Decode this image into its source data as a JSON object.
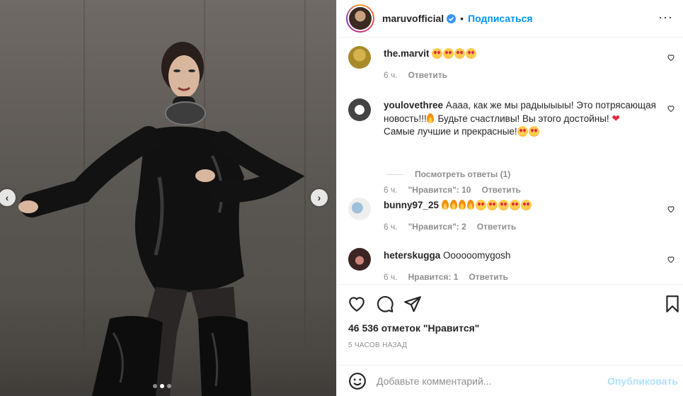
{
  "post": {
    "username": "maruvofficial",
    "follow_label": "Подписаться",
    "separator": "•",
    "more_label": "···"
  },
  "carousel": {
    "prev_label": "‹",
    "next_label": "›",
    "slides_count": 3,
    "active_slide": 2
  },
  "comments": [
    {
      "username": "the.marvit",
      "text": "",
      "emoji_after": [
        "star-struck",
        "star-struck",
        "star-struck",
        "star-struck"
      ],
      "time": "6 ч.",
      "reply_label": "Ответить"
    },
    {
      "username": "youlovethree",
      "text_part1": "Аааа, как же мы радыыыыы! Это потрясающая новость!!!",
      "text_part2": " Будьте счастливы! Вы этого достойны! ",
      "text_part3": "Самые лучшие и прекрасные!",
      "time": "6 ч.",
      "likes_label": "\"Нравится\": 10",
      "reply_label": "Ответить",
      "view_replies": "Посмотреть ответы (1)"
    },
    {
      "username": "bunny97_25",
      "text": "",
      "time": "6 ч.",
      "likes_label": "\"Нравится\": 2",
      "reply_label": "Ответить"
    },
    {
      "username": "heterskugga",
      "text": "Oooooomygosh",
      "time": "6 ч.",
      "likes_label": "Нравится: 1",
      "reply_label": "Ответить"
    }
  ],
  "footer": {
    "likes": "46 536 отметок \"Нравится\"",
    "time_ago": "5 ЧАСОВ НАЗАД",
    "comment_placeholder": "Добавьте комментарий...",
    "publish_label": "Опубликовать"
  },
  "colors": {
    "accent": "#0095f6",
    "muted": "#8e8e8e",
    "text": "#262626",
    "publish_disabled": "#b2dffc"
  },
  "icons": [
    "chevron-left-icon",
    "chevron-right-icon",
    "verified-icon",
    "more-icon",
    "heart-icon",
    "comment-icon",
    "share-icon",
    "bookmark-icon",
    "emoji-icon"
  ]
}
